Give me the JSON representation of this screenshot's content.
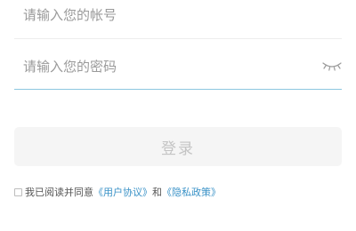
{
  "account_field": {
    "value": "",
    "placeholder": "请输入您的帐号"
  },
  "password_field": {
    "value": "",
    "placeholder": "请输入您的密码",
    "visibility_icon": "eye-closed-icon"
  },
  "login_button": {
    "label": "登录"
  },
  "agreement": {
    "checked": false,
    "prefix": "我已阅读并同意",
    "user_agreement_link": "《用户协议》",
    "conjunction": "和",
    "privacy_policy_link": "《隐私政策》"
  },
  "colors": {
    "link": "#3a92c7",
    "active_underline": "#8cc7e0",
    "button_bg": "#f5f5f5",
    "button_text": "#c4c4c4",
    "placeholder": "#9a9a9a"
  }
}
